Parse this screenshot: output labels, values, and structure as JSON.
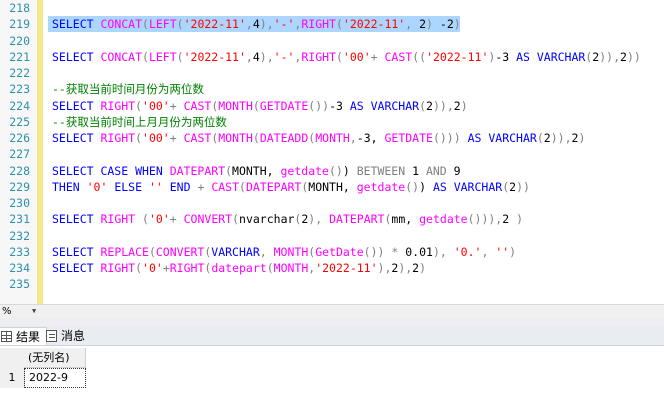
{
  "editor": {
    "line_numbers": [
      "218",
      "219",
      "220",
      "221",
      "222",
      "223",
      "224",
      "225",
      "226",
      "227",
      "228",
      "229",
      "230",
      "231",
      "232",
      "233",
      "234",
      "235"
    ],
    "lines": [
      [],
      [
        [
          "kw",
          "SELECT "
        ],
        [
          "fn",
          "CONCAT"
        ],
        [
          "op",
          "("
        ],
        [
          "fn",
          "LEFT"
        ],
        [
          "op",
          "("
        ],
        [
          "str",
          "'2022-11'"
        ],
        [
          "op",
          ","
        ],
        [
          "tx",
          "4"
        ],
        [
          "op",
          "),"
        ],
        [
          "str",
          "'-'"
        ],
        [
          "op",
          ","
        ],
        [
          "fn",
          "RIGHT"
        ],
        [
          "op",
          "("
        ],
        [
          "str",
          "'2022-11'"
        ],
        [
          "op",
          ","
        ],
        [
          "tx",
          " 2"
        ],
        [
          "op",
          ")"
        ],
        [
          "tx",
          " -2"
        ],
        [
          "op",
          ")"
        ]
      ],
      [],
      [
        [
          "kw",
          "SELECT "
        ],
        [
          "fn",
          "CONCAT"
        ],
        [
          "op",
          "("
        ],
        [
          "fn",
          "LEFT"
        ],
        [
          "op",
          "("
        ],
        [
          "str",
          "'2022-11'"
        ],
        [
          "op",
          ","
        ],
        [
          "tx",
          "4"
        ],
        [
          "op",
          "),"
        ],
        [
          "str",
          "'-'"
        ],
        [
          "op",
          ","
        ],
        [
          "fn",
          "RIGHT"
        ],
        [
          "op",
          "("
        ],
        [
          "str",
          "'00'"
        ],
        [
          "op",
          "+"
        ],
        [
          "tx",
          " "
        ],
        [
          "fn",
          "CAST"
        ],
        [
          "op",
          "(("
        ],
        [
          "str",
          "'2022-11'"
        ],
        [
          "op",
          ")"
        ],
        [
          "tx",
          "-3 "
        ],
        [
          "kw",
          "AS VARCHAR"
        ],
        [
          "op",
          "("
        ],
        [
          "tx",
          "2"
        ],
        [
          "op",
          ")),"
        ],
        [
          "tx",
          "2"
        ],
        [
          "op",
          "))"
        ]
      ],
      [],
      [
        [
          "cm",
          "--获取当前时间月份为两位数"
        ]
      ],
      [
        [
          "kw",
          "SELECT "
        ],
        [
          "fn",
          "RIGHT"
        ],
        [
          "op",
          "("
        ],
        [
          "str",
          "'00'"
        ],
        [
          "op",
          "+"
        ],
        [
          "tx",
          " "
        ],
        [
          "fn",
          "CAST"
        ],
        [
          "op",
          "("
        ],
        [
          "fn",
          "MONTH"
        ],
        [
          "op",
          "("
        ],
        [
          "fn",
          "GETDATE"
        ],
        [
          "op",
          "())"
        ],
        [
          "tx",
          "-3 "
        ],
        [
          "kw",
          "AS VARCHAR"
        ],
        [
          "op",
          "("
        ],
        [
          "tx",
          "2"
        ],
        [
          "op",
          "))"
        ],
        [
          "op",
          ","
        ],
        [
          "tx",
          "2"
        ],
        [
          "op",
          ")"
        ]
      ],
      [
        [
          "cm",
          "--获取当前时间上月月份为两位数"
        ]
      ],
      [
        [
          "kw",
          "SELECT "
        ],
        [
          "fn",
          "RIGHT"
        ],
        [
          "op",
          "("
        ],
        [
          "str",
          "'00'"
        ],
        [
          "op",
          "+"
        ],
        [
          "tx",
          " "
        ],
        [
          "fn",
          "CAST"
        ],
        [
          "op",
          "("
        ],
        [
          "fn",
          "MONTH"
        ],
        [
          "op",
          "("
        ],
        [
          "fn",
          "DATEADD"
        ],
        [
          "op",
          "("
        ],
        [
          "fn",
          "MONTH"
        ],
        [
          "op",
          ","
        ],
        [
          "tx",
          "-3, "
        ],
        [
          "fn",
          "GETDATE"
        ],
        [
          "op",
          "()))"
        ],
        [
          "tx",
          " "
        ],
        [
          "kw",
          "AS VARCHAR"
        ],
        [
          "op",
          "("
        ],
        [
          "tx",
          "2"
        ],
        [
          "op",
          "))"
        ],
        [
          "op",
          ","
        ],
        [
          "tx",
          "2"
        ],
        [
          "op",
          ")"
        ]
      ],
      [],
      [
        [
          "kw",
          "SELECT CASE WHEN "
        ],
        [
          "fn",
          "DATEPART"
        ],
        [
          "op",
          "("
        ],
        [
          "tx",
          "MONTH, "
        ],
        [
          "fn",
          "getdate"
        ],
        [
          "op",
          "()"
        ],
        [
          "tx",
          ") "
        ],
        [
          "gr",
          "BETWEEN"
        ],
        [
          "tx",
          " 1 "
        ],
        [
          "gr",
          "AND"
        ],
        [
          "tx",
          " 9"
        ]
      ],
      [
        [
          "kw",
          "THEN "
        ],
        [
          "str",
          "'0'"
        ],
        [
          "kw",
          " ELSE "
        ],
        [
          "str",
          "''"
        ],
        [
          "kw",
          " END "
        ],
        [
          "op",
          "+"
        ],
        [
          "tx",
          " "
        ],
        [
          "fn",
          "CAST"
        ],
        [
          "op",
          "("
        ],
        [
          "fn",
          "DATEPART"
        ],
        [
          "op",
          "("
        ],
        [
          "tx",
          "MONTH, "
        ],
        [
          "fn",
          "getdate"
        ],
        [
          "op",
          "()"
        ],
        [
          "tx",
          ") "
        ],
        [
          "kw",
          "AS VARCHAR"
        ],
        [
          "op",
          "("
        ],
        [
          "tx",
          "2"
        ],
        [
          "op",
          "))"
        ]
      ],
      [],
      [
        [
          "kw",
          "SELECT "
        ],
        [
          "fn",
          "RIGHT"
        ],
        [
          "tx",
          " "
        ],
        [
          "op",
          "("
        ],
        [
          "str",
          "'0'"
        ],
        [
          "op",
          "+"
        ],
        [
          "tx",
          " "
        ],
        [
          "fn",
          "CONVERT"
        ],
        [
          "op",
          "("
        ],
        [
          "tx",
          "nvarchar"
        ],
        [
          "op",
          "("
        ],
        [
          "tx",
          "2"
        ],
        [
          "op",
          "),"
        ],
        [
          "tx",
          " "
        ],
        [
          "fn",
          "DATEPART"
        ],
        [
          "op",
          "("
        ],
        [
          "tx",
          "mm, "
        ],
        [
          "fn",
          "getdate"
        ],
        [
          "op",
          "())),"
        ],
        [
          "tx",
          "2 "
        ],
        [
          "op",
          ")"
        ]
      ],
      [],
      [
        [
          "kw",
          "SELECT "
        ],
        [
          "fn",
          "REPLACE"
        ],
        [
          "op",
          "("
        ],
        [
          "fn",
          "CONVERT"
        ],
        [
          "op",
          "("
        ],
        [
          "kw",
          "VARCHAR"
        ],
        [
          "op",
          ","
        ],
        [
          "tx",
          " "
        ],
        [
          "fn",
          "MONTH"
        ],
        [
          "op",
          "("
        ],
        [
          "fn",
          "GetDate"
        ],
        [
          "op",
          "())"
        ],
        [
          "tx",
          " "
        ],
        [
          "op",
          "*"
        ],
        [
          "tx",
          " 0.01"
        ],
        [
          "op",
          "),"
        ],
        [
          "tx",
          " "
        ],
        [
          "str",
          "'0.'"
        ],
        [
          "op",
          ","
        ],
        [
          "tx",
          " "
        ],
        [
          "str",
          "''"
        ],
        [
          "op",
          ")"
        ]
      ],
      [
        [
          "kw",
          "SELECT "
        ],
        [
          "fn",
          "RIGHT"
        ],
        [
          "op",
          "("
        ],
        [
          "str",
          "'0'"
        ],
        [
          "op",
          "+"
        ],
        [
          "fn",
          "RIGHT"
        ],
        [
          "op",
          "("
        ],
        [
          "fn",
          "datepart"
        ],
        [
          "op",
          "("
        ],
        [
          "fn",
          "MONTH"
        ],
        [
          "op",
          ","
        ],
        [
          "str",
          "'2022-11'"
        ],
        [
          "op",
          "),"
        ],
        [
          "tx",
          "2"
        ],
        [
          "op",
          "),"
        ],
        [
          "tx",
          "2"
        ],
        [
          "op",
          ")"
        ]
      ],
      []
    ]
  },
  "status": {
    "zoom": "%"
  },
  "tabs": {
    "results_label": "结果",
    "messages_label": "消息"
  },
  "results": {
    "column_header": "(无列名)",
    "row_number": "1",
    "cell_value": "2022-9"
  }
}
